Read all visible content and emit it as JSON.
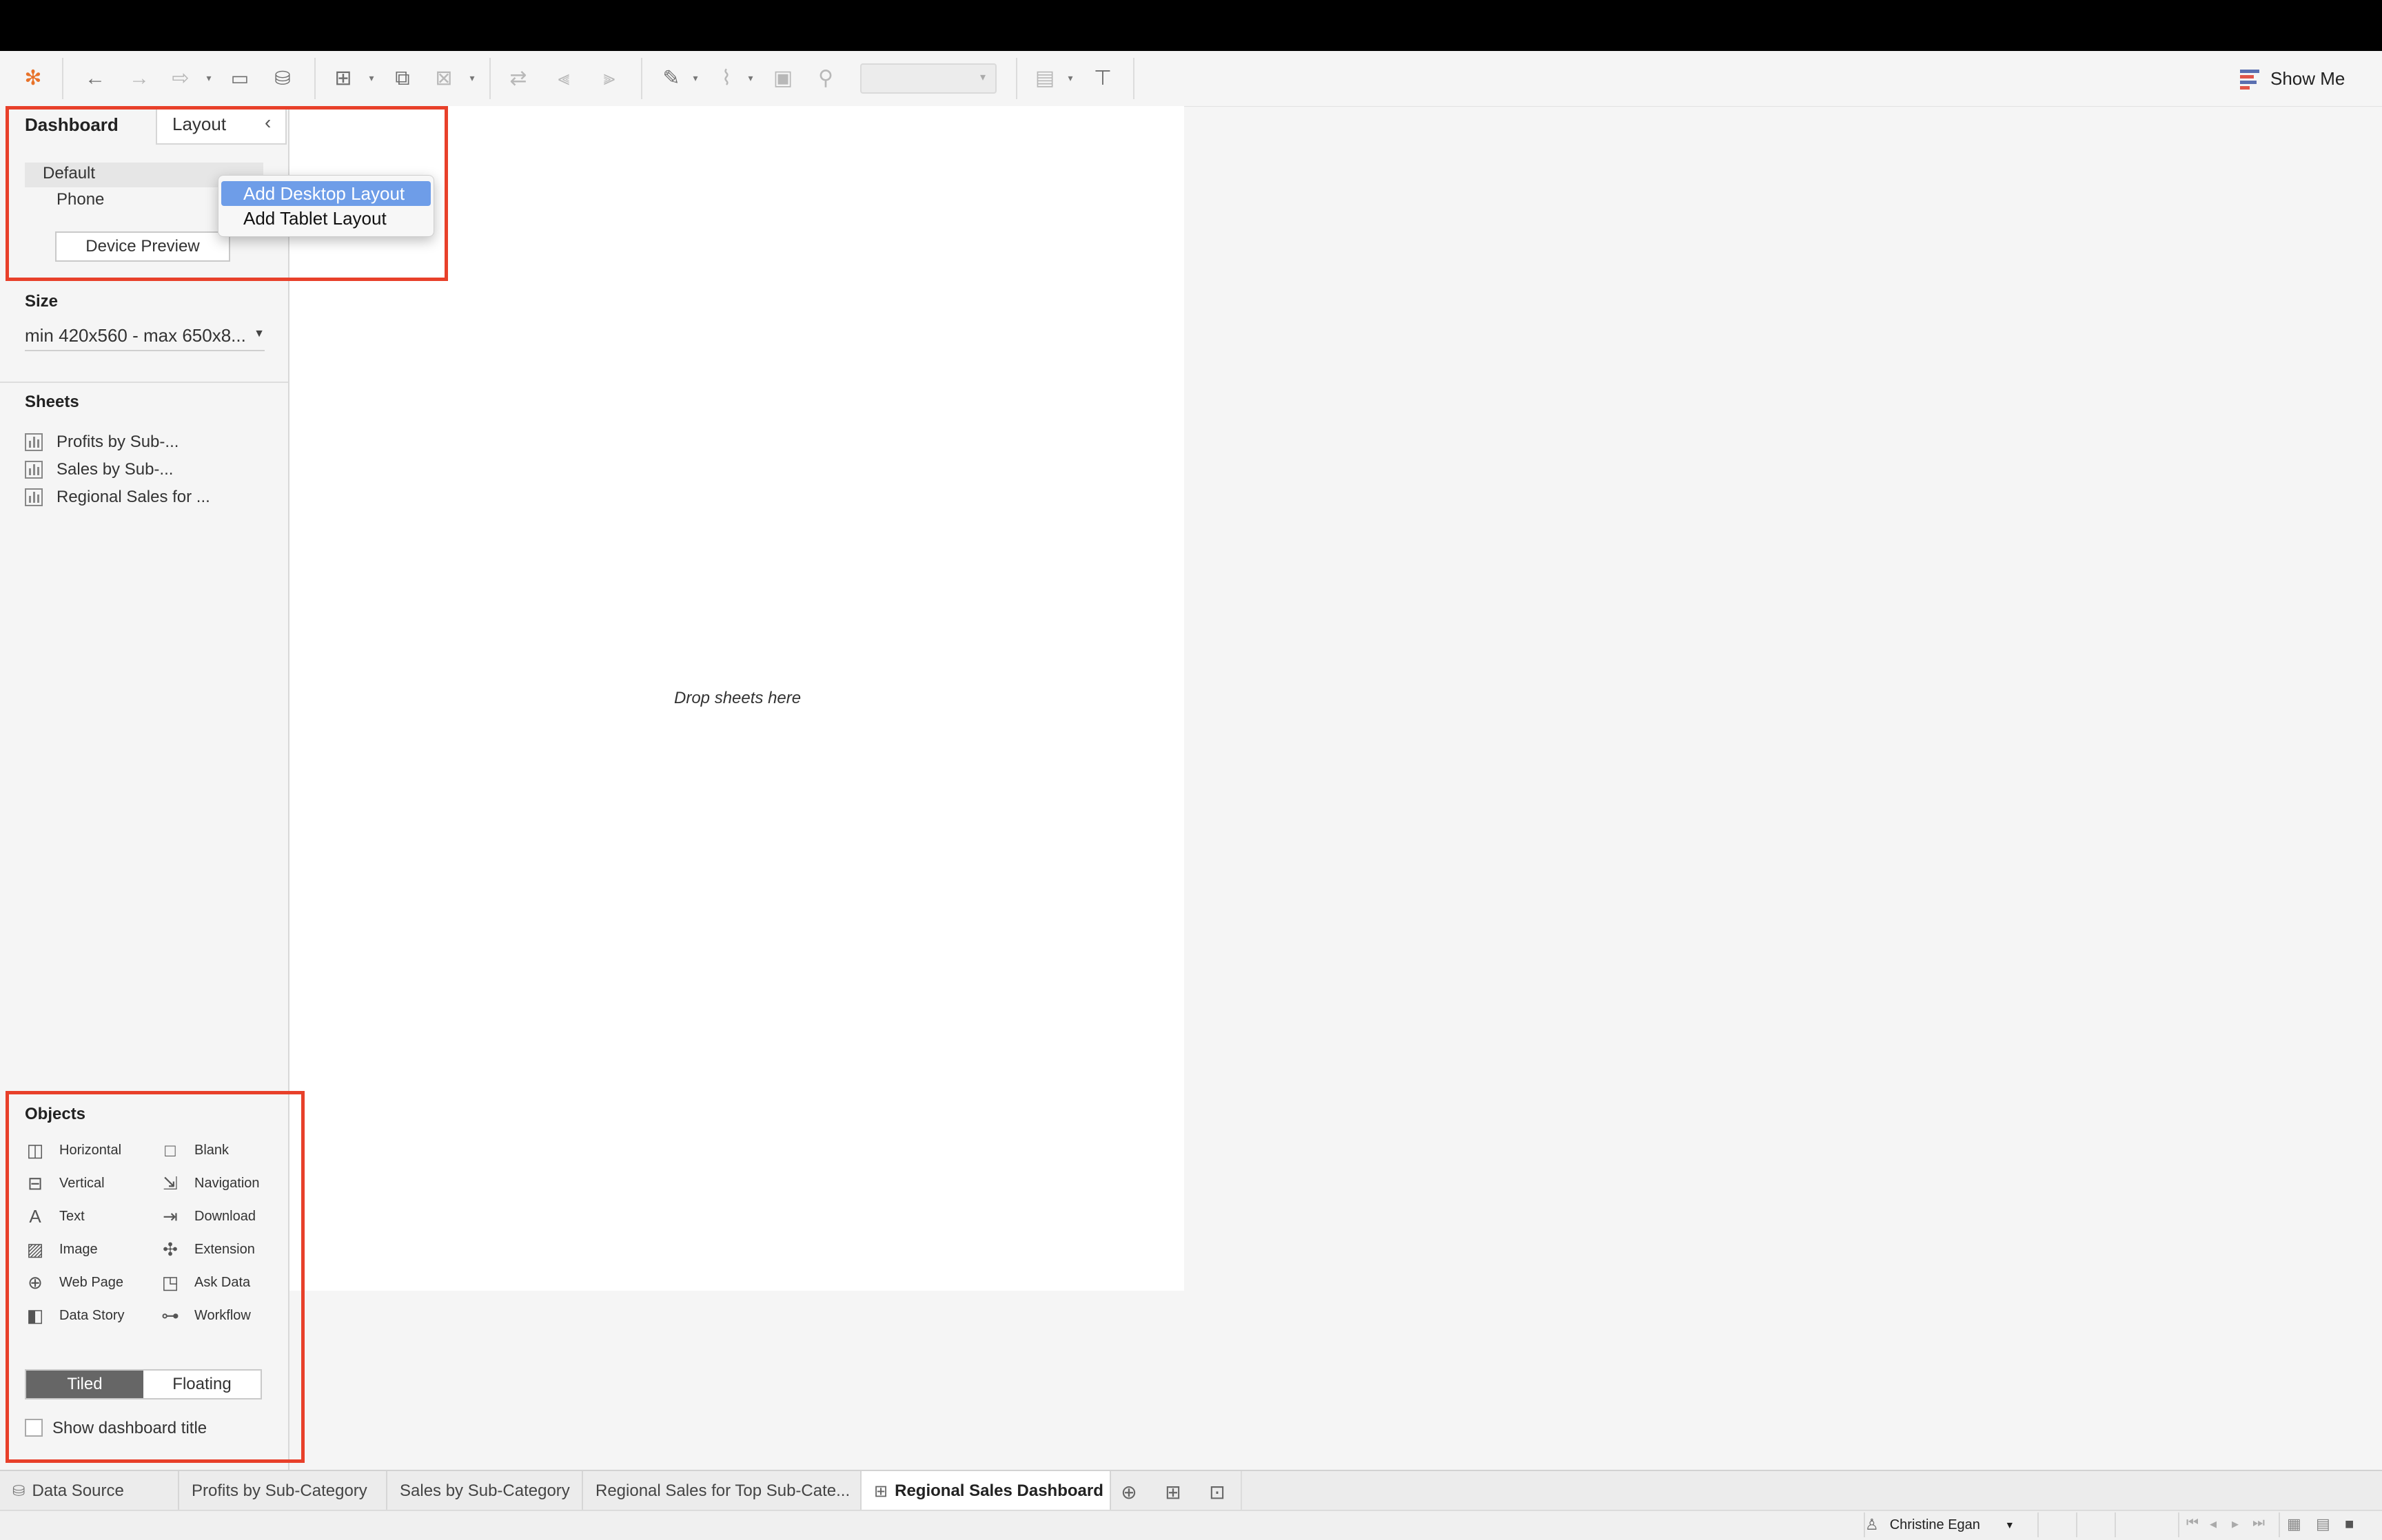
{
  "toolbar": {
    "icons": [
      "tableau-logo-icon",
      "undo-icon",
      "redo-icon",
      "replay-icon",
      "save-icon",
      "new-data-source-icon",
      "new-worksheet-icon",
      "duplicate-sheet-icon",
      "clear-sheet-icon",
      "swap-icon",
      "sort-ascending-icon",
      "sort-descending-icon",
      "highlight-icon",
      "group-icon",
      "label-icon",
      "pin-icon",
      "fit-dropdown",
      "show-cards-icon",
      "presentation-mode-icon"
    ],
    "show_me_label": "Show Me"
  },
  "sidebar": {
    "tab_dashboard": "Dashboard",
    "tab_layout": "Layout",
    "device_default": "Default",
    "device_phone": "Phone",
    "device_preview_button": "Device Preview",
    "size_heading": "Size",
    "size_value": "min 420x560 - max 650x8...",
    "sheets_heading": "Sheets",
    "sheets": [
      "Profits by Sub-...",
      "Sales by Sub-...",
      "Regional Sales for ..."
    ],
    "objects_heading": "Objects",
    "objects_left": [
      {
        "label": "Horizontal",
        "icon": "horizontal-container-icon"
      },
      {
        "label": "Vertical",
        "icon": "vertical-container-icon"
      },
      {
        "label": "Text",
        "icon": "text-icon"
      },
      {
        "label": "Image",
        "icon": "image-icon"
      },
      {
        "label": "Web Page",
        "icon": "globe-icon"
      },
      {
        "label": "Data Story",
        "icon": "book-icon"
      }
    ],
    "objects_right": [
      {
        "label": "Blank",
        "icon": "blank-icon"
      },
      {
        "label": "Navigation",
        "icon": "navigation-icon"
      },
      {
        "label": "Download",
        "icon": "download-icon"
      },
      {
        "label": "Extension",
        "icon": "extension-icon"
      },
      {
        "label": "Ask Data",
        "icon": "ask-data-icon"
      },
      {
        "label": "Workflow",
        "icon": "workflow-icon"
      }
    ],
    "tiled_label": "Tiled",
    "floating_label": "Floating",
    "show_title_label": "Show dashboard title"
  },
  "context_menu": {
    "items": [
      "Add Desktop Layout",
      "Add Tablet Layout"
    ],
    "highlighted_index": 0
  },
  "canvas": {
    "drop_hint": "Drop sheets here"
  },
  "sheet_tabs": {
    "data_source": "Data Source",
    "tabs": [
      "Profits by Sub-Category",
      "Sales by Sub-Category",
      "Regional Sales for Top Sub-Cate...",
      "Regional Sales Dashboard"
    ],
    "active_index": 3
  },
  "status": {
    "user_name": "Christine Egan"
  },
  "colors": {
    "highlight": "#e8402a",
    "menu_selection": "#6e9de8",
    "tiled_active": "#666666"
  }
}
